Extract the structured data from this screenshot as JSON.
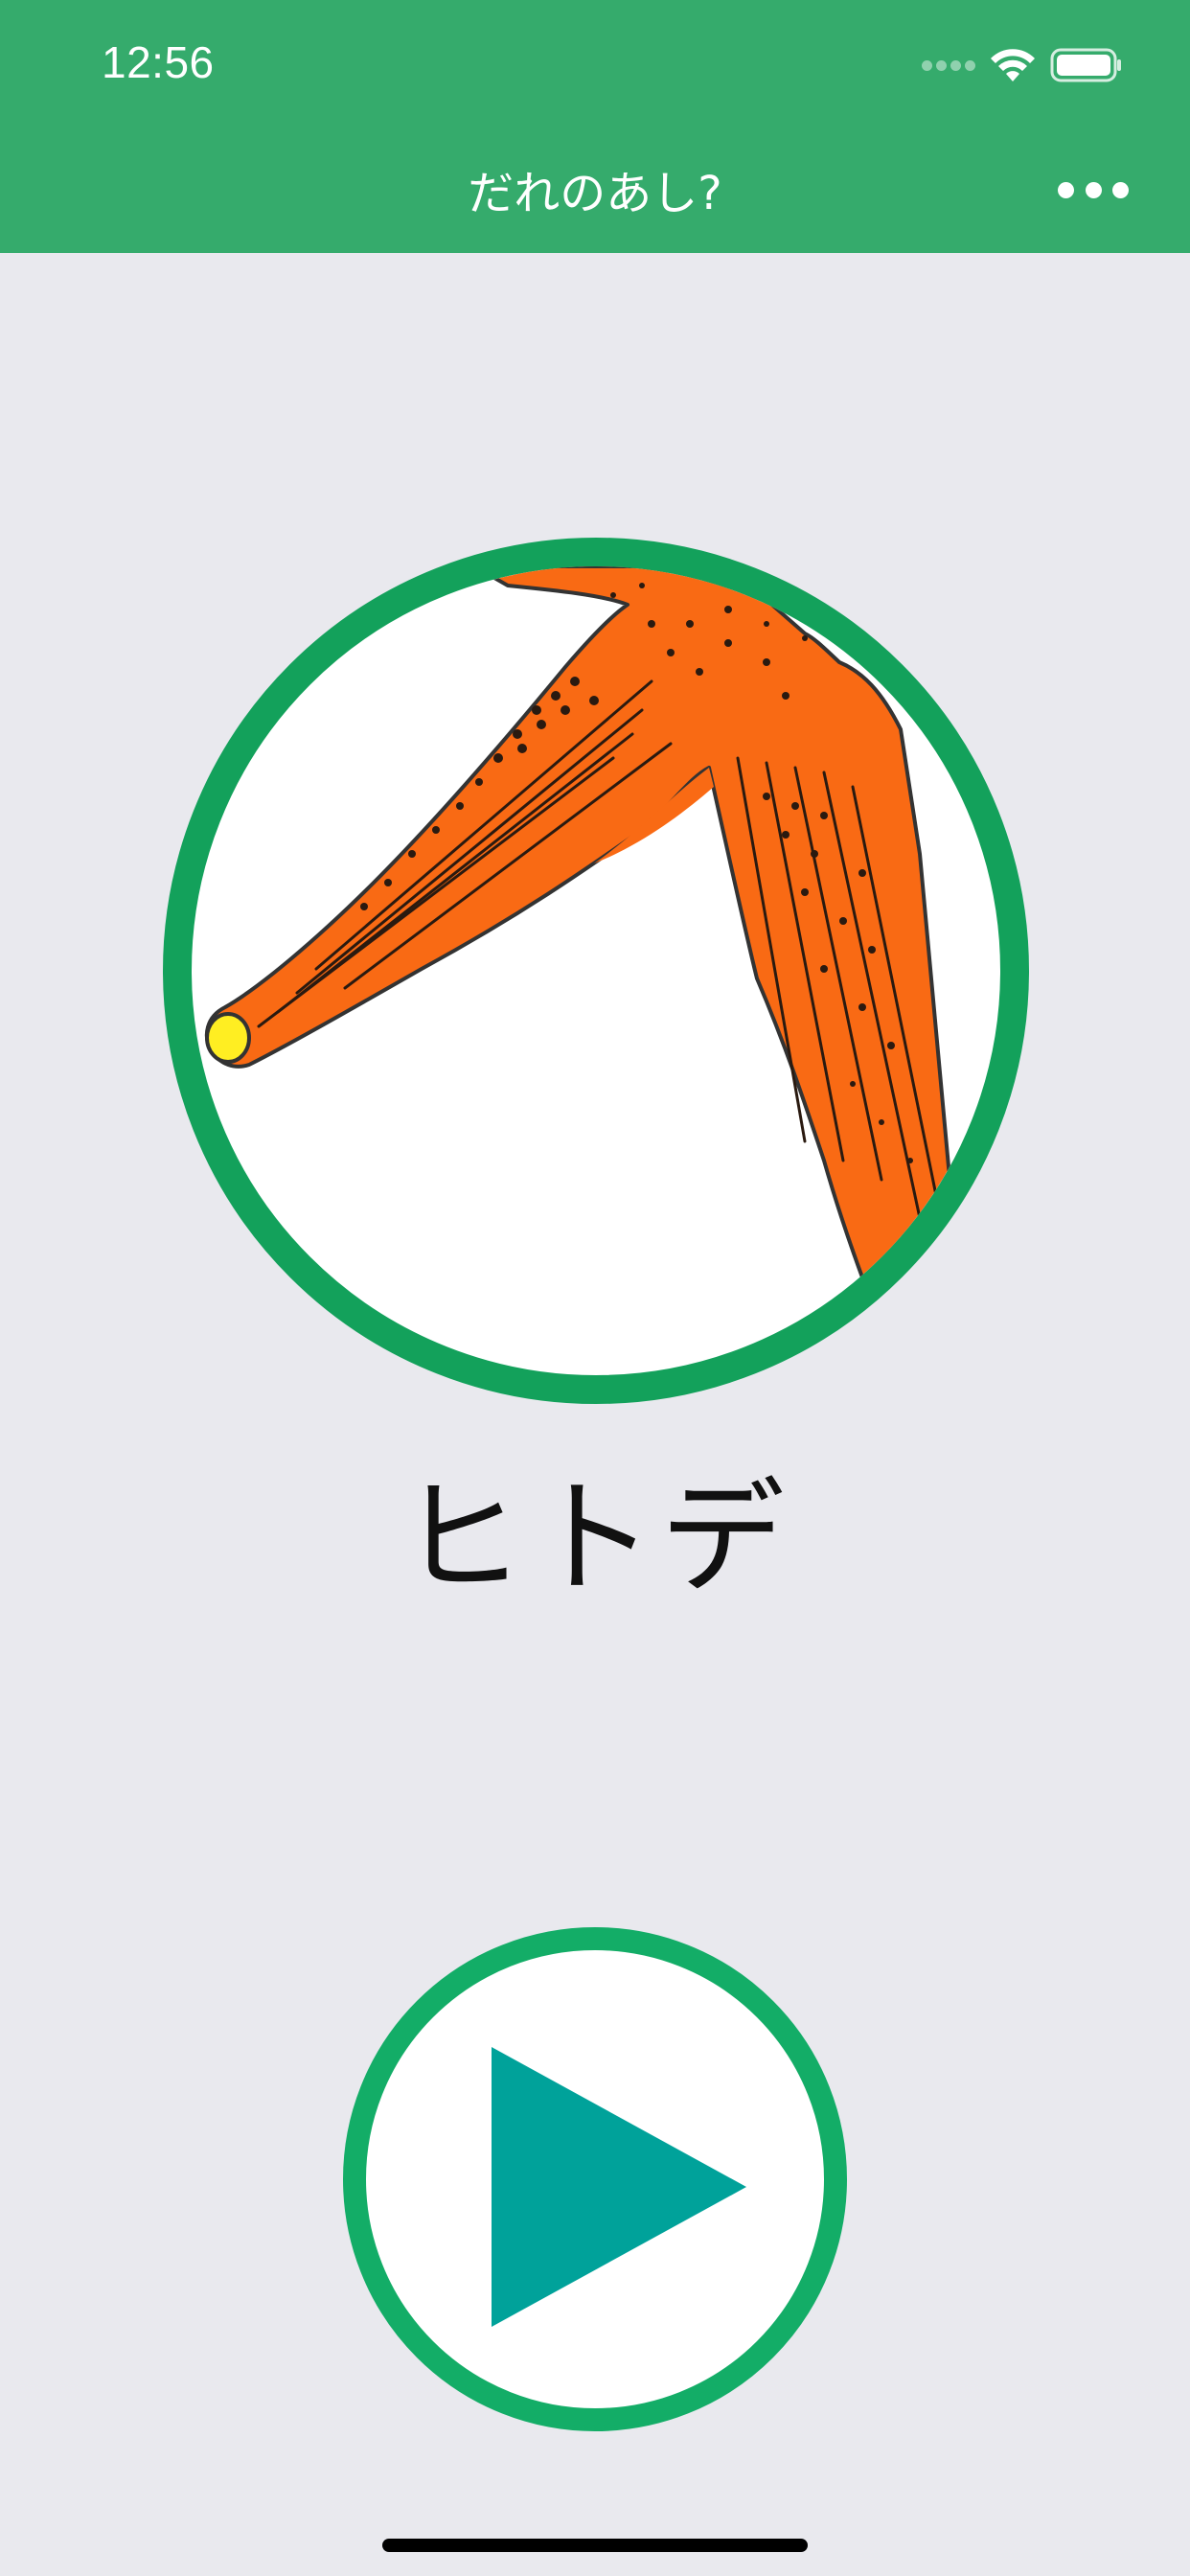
{
  "status_bar": {
    "time": "12:56",
    "background_color": "#35ab6c"
  },
  "nav_bar": {
    "title": "だれのあし?",
    "more_icon": "ellipsis-icon",
    "background_color": "#35ab6c"
  },
  "illustration": {
    "icon": "starfish-leg-illustration",
    "ring_color": "#13a15b",
    "fill_color": "#f96a14",
    "tip_color": "#ffee22"
  },
  "answer": {
    "name": "ヒトデ"
  },
  "play_button": {
    "icon": "play-icon",
    "ring_color": "#13ad67",
    "triangle_color": "#00a29a"
  }
}
